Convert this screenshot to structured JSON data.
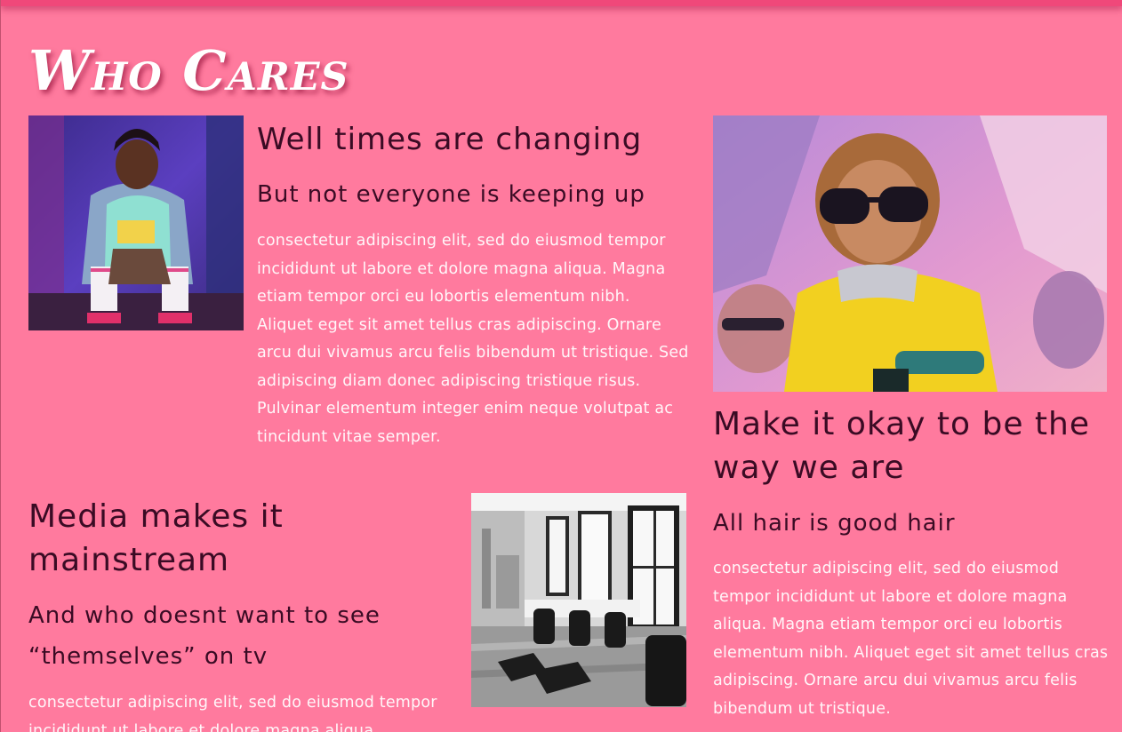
{
  "header": {
    "title": "Who Cares"
  },
  "section_changing": {
    "image_alt": "person in MTV sweatshirt",
    "heading": "Well times are changing",
    "subheading": "But not everyone is keeping up",
    "body": "consectetur adipiscing elit, sed do eiusmod tempor incididunt ut labore et dolore magna aliqua. Magna etiam tempor orci eu lobortis elementum nibh. Aliquet eget sit amet tellus cras adipiscing. Ornare arcu dui vivamus arcu felis bibendum ut tristique. Sed adipiscing diam donec adipiscing tristique risus. Pulvinar elementum integer enim neque volutpat ac tincidunt vitae semper."
  },
  "section_media": {
    "heading": "Media makes it mainstream",
    "subheading": "And who doesnt want to see “themselves” on tv",
    "body": "consectetur adipiscing elit, sed do eiusmod tempor incididunt ut labore et dolore magna aliqua."
  },
  "section_okay": {
    "heading": "Make it okay to be the way we are",
    "subheading": "All hair is good hair",
    "body": "consectetur adipiscing elit, sed do eiusmod tempor incididunt ut labore et dolore magna aliqua. Magna etiam tempor orci eu lobortis elementum nibh. Aliquet eget sit amet tellus cras adipiscing. Ornare arcu dui vivamus arcu felis bibendum ut tristique."
  },
  "colors": {
    "background": "#ff7a9e",
    "top_bar": "#f0487a",
    "heading_text": "#3a0b24",
    "body_text": "#fff6f9",
    "title_text": "#ffffff"
  }
}
